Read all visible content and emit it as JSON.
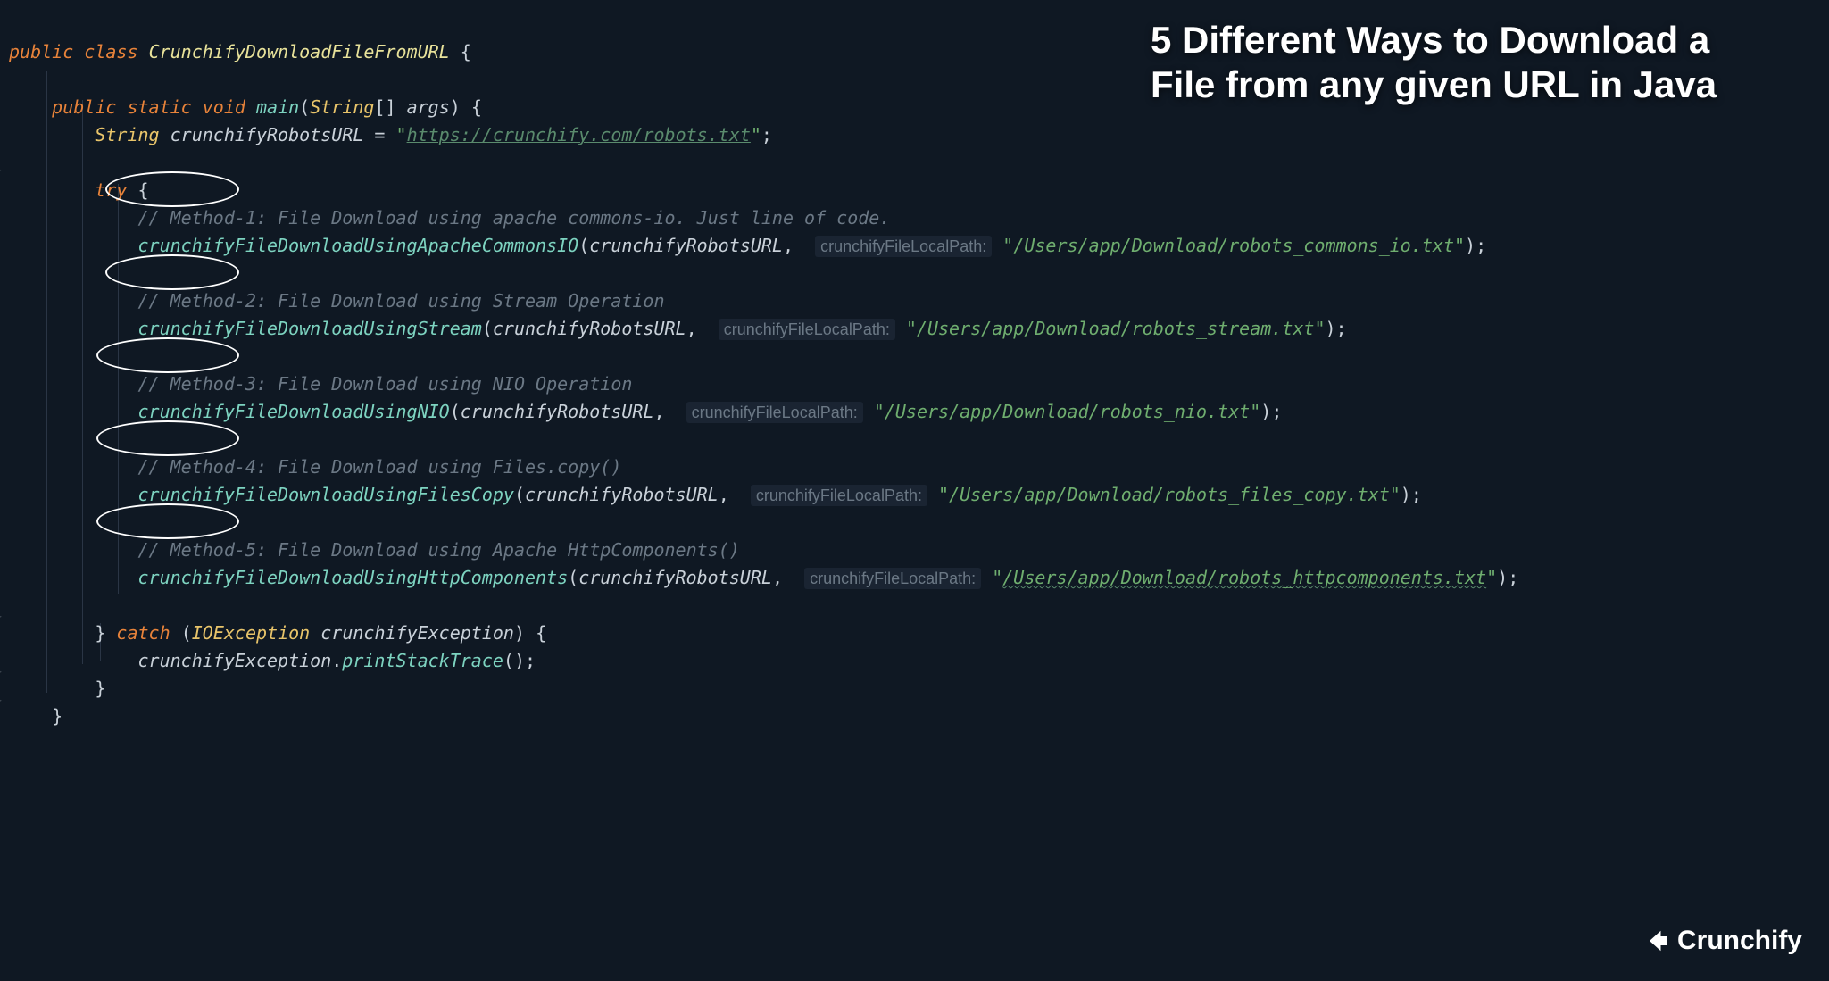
{
  "title": "5 Different Ways to Download a File from any given URL in Java",
  "brand": "Crunchify",
  "class_decl": {
    "kw_public": "public",
    "kw_class": "class",
    "name": "CrunchifyDownloadFileFromURL"
  },
  "main_decl": {
    "kw_public": "public",
    "kw_static": "static",
    "kw_void": "void",
    "name": "main",
    "param_type": "String",
    "param_name": "args"
  },
  "robots": {
    "type": "String",
    "var": "crunchifyRobotsURL",
    "eq": "=",
    "val": "https://crunchify.com/robots.txt"
  },
  "kw_try": "try",
  "kw_catch": "catch",
  "catch_type": "IOException",
  "catch_var": "crunchifyException",
  "stack_call": "printStackTrace",
  "param_hint": "crunchifyFileLocalPath:",
  "arg_var": "crunchifyRobotsURL",
  "methods": [
    {
      "cmt": "// Method-1:",
      "desc": " File Download using apache commons-io. Just line of code.",
      "fn": "crunchifyFileDownloadUsingApacheCommonsIO",
      "path": "/Users/app/Download/robots_commons_io.txt"
    },
    {
      "cmt": "// Method-2:",
      "desc": " File Download using Stream Operation",
      "fn": "crunchifyFileDownloadUsingStream",
      "path": "/Users/app/Download/robots_stream.txt"
    },
    {
      "cmt": "// Method-3:",
      "desc": " File Download using NIO Operation",
      "fn": "crunchifyFileDownloadUsingNIO",
      "path": "/Users/app/Download/robots_nio.txt"
    },
    {
      "cmt": "// Method-4:",
      "desc": " File Download using Files.copy()",
      "fn": "crunchifyFileDownloadUsingFilesCopy",
      "path": "/Users/app/Download/robots_files_copy.txt"
    },
    {
      "cmt": "// Method-5:",
      "desc": " File Download using Apache HttpComponents()",
      "fn": "crunchifyFileDownloadUsingHttpComponents",
      "path": "/Users/app/Download/robots_httpcomponents.txt"
    }
  ]
}
